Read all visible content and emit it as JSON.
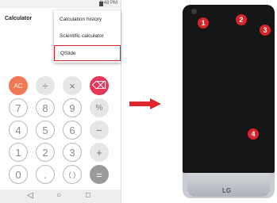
{
  "status_bar": {
    "time": "3:48 PM"
  },
  "app": {
    "title": "Calculator"
  },
  "menu": {
    "items": [
      {
        "label": "Calculation history"
      },
      {
        "label": "Scientific calculator"
      },
      {
        "label": "QSlide"
      }
    ],
    "highlight_color": "#d8232a"
  },
  "keypad": {
    "rows": [
      [
        "AC",
        "÷",
        "×",
        "⌫"
      ],
      [
        "7",
        "8",
        "9",
        "%"
      ],
      [
        "4",
        "5",
        "6",
        "−"
      ],
      [
        "1",
        "2",
        "3",
        "+"
      ],
      [
        "0",
        ".",
        "( )",
        "="
      ]
    ]
  },
  "nav": {
    "back": "◁",
    "home": "○",
    "recent": "□"
  },
  "device": {
    "brand": "LG",
    "callouts": [
      "1",
      "2",
      "3",
      "4"
    ],
    "callout_color": "#d8232a"
  },
  "colors": {
    "accent_orange": "#f07854",
    "delete_pink": "#e6365a",
    "arrow_red": "#e0262c"
  }
}
